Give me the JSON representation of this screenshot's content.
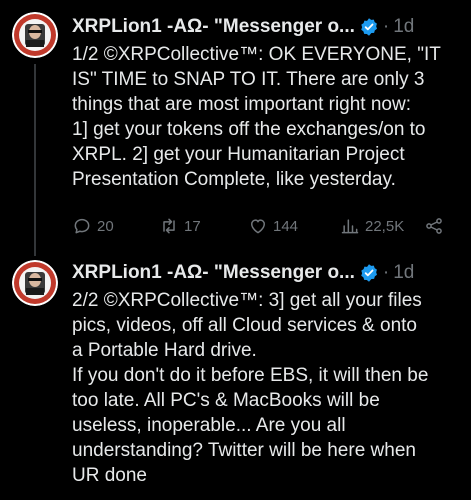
{
  "colors": {
    "background": "#000000",
    "text": "#e7e9ea",
    "muted": "#71767b",
    "verified": "#1d9bf0"
  },
  "tweets": [
    {
      "author": "XRPLion1 -AΩ- \"Messenger o...",
      "separator": "·",
      "time": "1d",
      "lines": [
        "1/2 ©XRPCollective™: OK EVERYONE, \"IT",
        "IS\" TIME to SNAP TO IT. There are only 3",
        "things that are most important right now:",
        "1] get your tokens off the exchanges/on to",
        "XRPL. 2] get your Humanitarian Project",
        "Presentation Complete, like yesterday."
      ],
      "actions": {
        "reply_count": "20",
        "retweet_count": "17",
        "like_count": "144",
        "view_count": "22,5K"
      },
      "icons": [
        "reply-icon",
        "retweet-icon",
        "like-icon",
        "views-icon",
        "share-icon"
      ]
    },
    {
      "author": "XRPLion1 -AΩ- \"Messenger o...",
      "separator": "·",
      "time": "1d",
      "lines": [
        "2/2 ©XRPCollective™: 3] get all your files",
        "pics, videos, off all Cloud services & onto",
        "a Portable Hard drive.",
        "If you don't do it before EBS, it will then be",
        "too late. All PC's & MacBooks will be",
        "useless, inoperable... Are you all",
        "understanding? Twitter will be here when",
        "UR done"
      ]
    }
  ]
}
